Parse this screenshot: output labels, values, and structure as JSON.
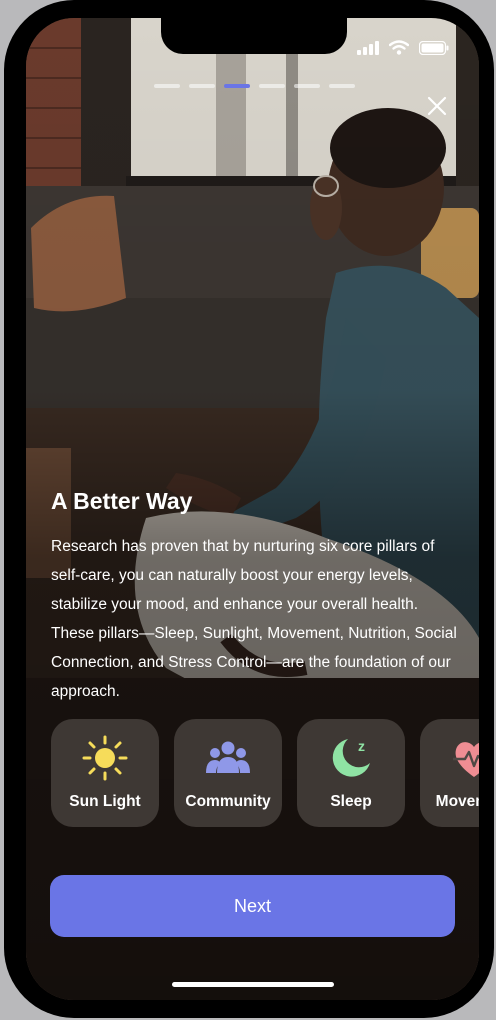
{
  "onboarding": {
    "progress": {
      "total_steps": 6,
      "current_step": 3
    },
    "title": "A Better Way",
    "body": "Research has proven that by nurturing six core pillars of self-care, you can naturally boost your energy levels, stabilize your mood, and enhance your overall health. These pillars—Sleep, Sunlight, Movement, Nutrition, Social Connection, and Stress Control—are the foundation of our approach.",
    "pillars": [
      {
        "label": "Sun Light",
        "icon": "sun-icon",
        "color": "#f6dc5a"
      },
      {
        "label": "Community",
        "icon": "people-icon",
        "color": "#8f98e8"
      },
      {
        "label": "Sleep",
        "icon": "moon-icon",
        "color": "#8fe3a4"
      },
      {
        "label": "Movement",
        "icon": "heartbeat-icon",
        "color": "#ef8d93"
      }
    ],
    "next_label": "Next"
  },
  "colors": {
    "accent": "#6a75e6",
    "text": "#ffffff"
  },
  "background_image": "person-meditating-photo"
}
